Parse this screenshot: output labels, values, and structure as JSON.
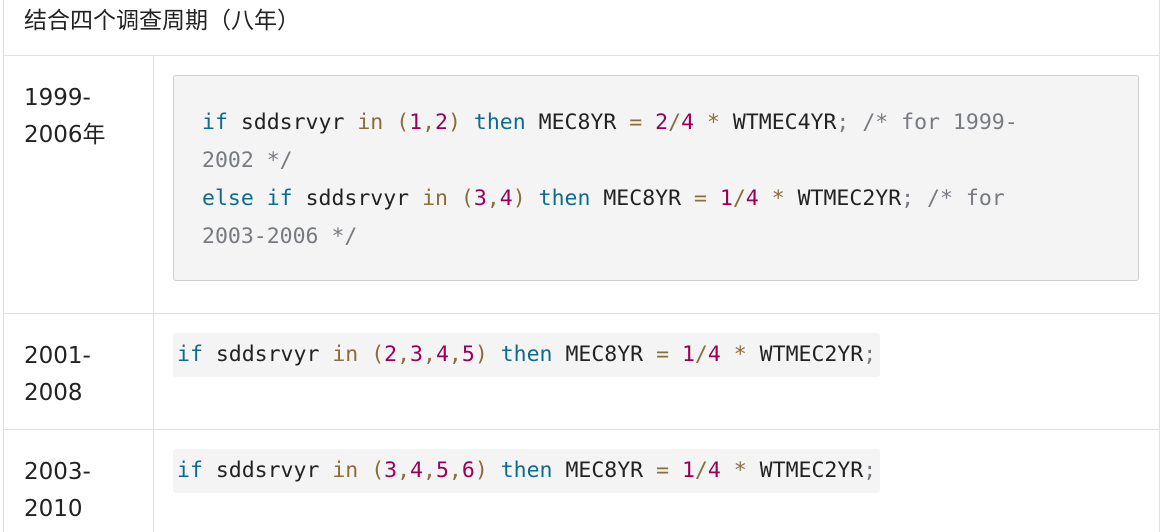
{
  "header": {
    "title": "结合四个调查周期（八年）"
  },
  "rows": [
    {
      "year_line1": "1999-",
      "year_line2": "2006年",
      "code": {
        "l1": {
          "kw1": "if",
          "var": " sddsrvyr ",
          "in": "in",
          "sp1": " ",
          "lp": "(",
          "n1": "1",
          "c": ",",
          "n2": "2",
          "rp": ")",
          "sp2": " ",
          "then": "then",
          "tgt": " MEC8YR ",
          "eq": "=",
          "sp3": " ",
          "a": "2",
          "sl": "/",
          "b": "4",
          "sp4": " ",
          "mul": "*",
          "src": " WTMEC4YR",
          "semi": ";",
          "comment": " /* for 1999-"
        },
        "l2": {
          "comment": "2002 */"
        },
        "l3": {
          "kw0": "else",
          "sp0": " ",
          "kw1": "if",
          "var": " sddsrvyr ",
          "in": "in",
          "sp1": " ",
          "lp": "(",
          "n1": "3",
          "c": ",",
          "n2": "4",
          "rp": ")",
          "sp2": " ",
          "then": "then",
          "tgt": " MEC8YR ",
          "eq": "=",
          "sp3": " ",
          "a": "1",
          "sl": "/",
          "b": "4",
          "sp4": " ",
          "mul": "*",
          "src": " WTMEC2YR",
          "semi": ";",
          "comment": " /* for"
        },
        "l4": {
          "comment": "2003-2006 */"
        }
      }
    },
    {
      "year_line1": "2001-",
      "year_line2": "2008",
      "code": {
        "kw1": "if",
        "var": " sddsrvyr ",
        "in": "in",
        "sp1": " ",
        "lp": "(",
        "n1": "2",
        "c1": ",",
        "n2": "3",
        "c2": ",",
        "n3": "4",
        "c3": ",",
        "n4": "5",
        "rp": ")",
        "sp2": " ",
        "then": "then",
        "tgt": " MEC8YR ",
        "eq": "=",
        "sp3": " ",
        "a": "1",
        "sl": "/",
        "b": "4",
        "sp4": " ",
        "mul": "*",
        "src": " WTMEC2YR",
        "semi": ";"
      }
    },
    {
      "year_line1": "2003-",
      "year_line2": "2010",
      "code": {
        "kw1": "if",
        "var": " sddsrvyr ",
        "in": "in",
        "sp1": " ",
        "lp": "(",
        "n1": "3",
        "c1": ",",
        "n2": "4",
        "c2": ",",
        "n3": "5",
        "c3": ",",
        "n4": "6",
        "rp": ")",
        "sp2": " ",
        "then": "then",
        "tgt": " MEC8YR ",
        "eq": "=",
        "sp3": " ",
        "a": "1",
        "sl": "/",
        "b": "4",
        "sp4": " ",
        "mul": "*",
        "src": " WTMEC2YR",
        "semi": ";"
      }
    }
  ]
}
